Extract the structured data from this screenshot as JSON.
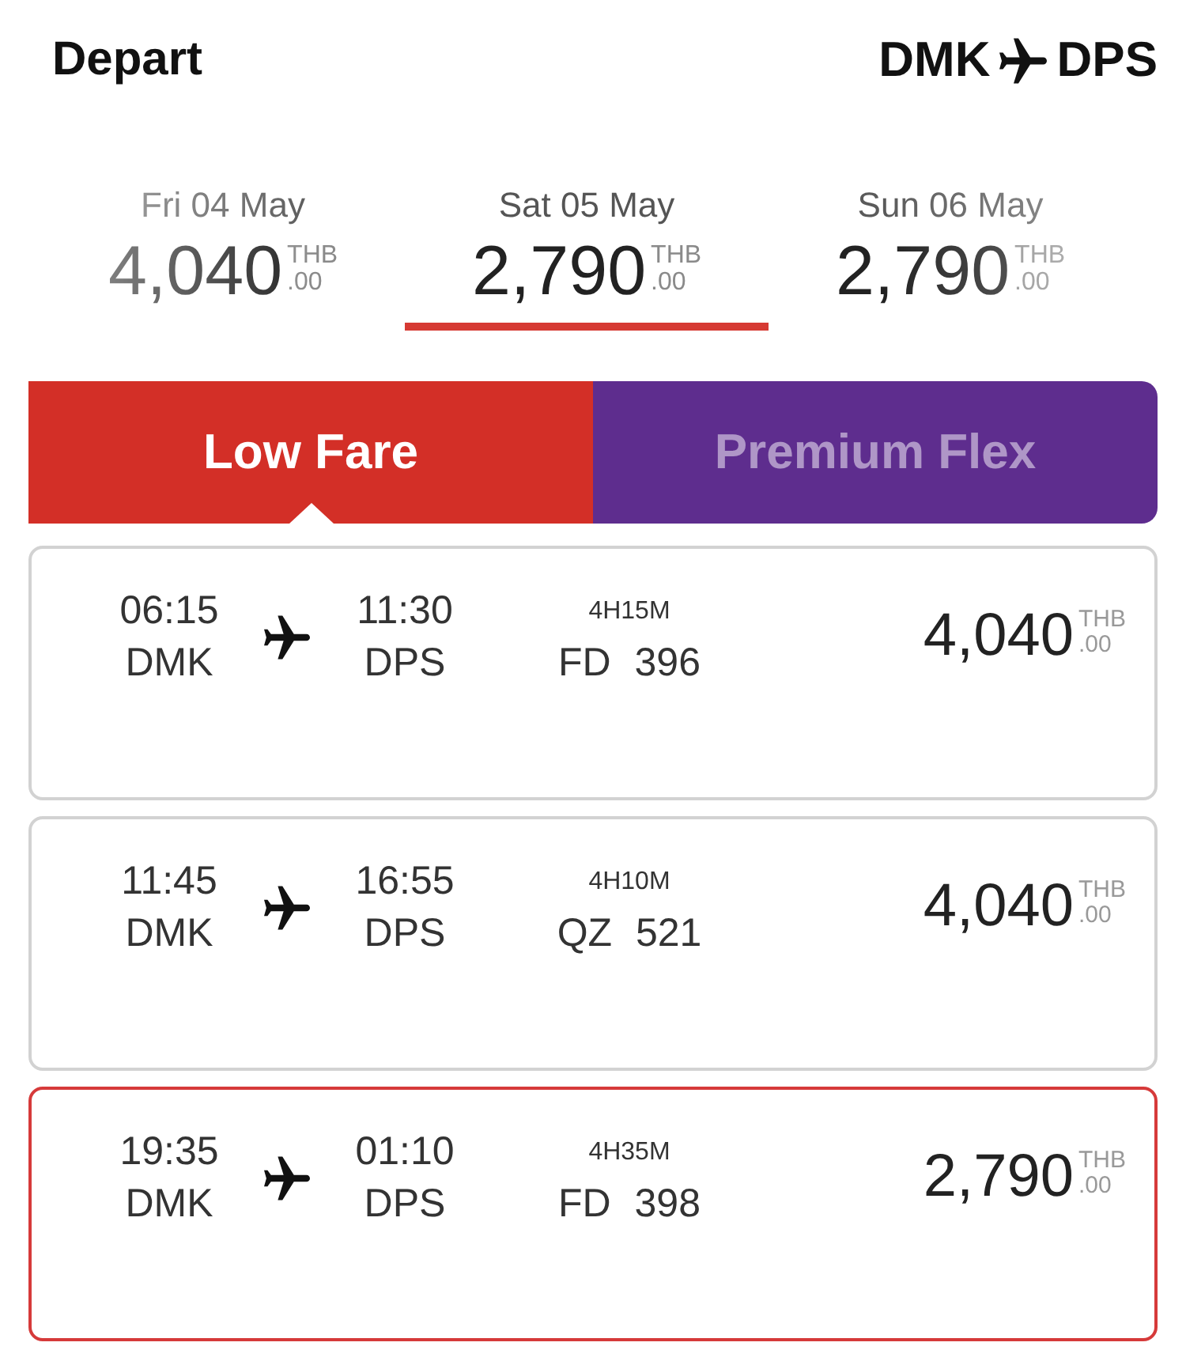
{
  "header": {
    "title": "Depart",
    "origin": "DMK",
    "destination": "DPS"
  },
  "dates": [
    {
      "label": "Fri 04 May",
      "price": "4,040",
      "currency": "THB",
      "cents": ".00",
      "selected": false
    },
    {
      "label": "Sat 05 May",
      "price": "2,790",
      "currency": "THB",
      "cents": ".00",
      "selected": true
    },
    {
      "label": "Sun 06 May",
      "price": "2,790",
      "currency": "THB",
      "cents": ".00",
      "selected": false
    }
  ],
  "fare_tabs": [
    {
      "label": "Low Fare",
      "selected": true,
      "color": "#d32f27"
    },
    {
      "label": "Premium Flex",
      "selected": false,
      "color": "#5e2d8e"
    }
  ],
  "flights": [
    {
      "depart_time": "06:15",
      "origin": "DMK",
      "arrive_time": "11:30",
      "destination": "DPS",
      "duration": "4H15M",
      "flight_number": "FD 396",
      "price": "4,040",
      "currency": "THB",
      "cents": ".00",
      "selected": false
    },
    {
      "depart_time": "11:45",
      "origin": "DMK",
      "arrive_time": "16:55",
      "destination": "DPS",
      "duration": "4H10M",
      "flight_number": "QZ 521",
      "price": "4,040",
      "currency": "THB",
      "cents": ".00",
      "selected": false
    },
    {
      "depart_time": "19:35",
      "origin": "DMK",
      "arrive_time": "01:10",
      "destination": "DPS",
      "duration": "4H35M",
      "flight_number": "FD 398",
      "price": "2,790",
      "currency": "THB",
      "cents": ".00",
      "selected": true
    }
  ]
}
